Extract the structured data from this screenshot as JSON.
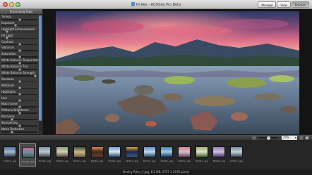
{
  "window": {
    "title": "Hi Res - ACDSee Pro Beta",
    "modes": [
      {
        "label": "Manage",
        "active": false
      },
      {
        "label": "View",
        "active": false
      },
      {
        "label": "Process",
        "active": true
      }
    ]
  },
  "tools_panel": {
    "header": "Processing Tools",
    "tools": [
      {
        "label": "Tuning",
        "level": 0.5
      },
      {
        "label": "Exposure",
        "level": 0.4
      },
      {
        "label": "Highlight Enhancement",
        "level": 0.15
      },
      {
        "label": "Fill Light",
        "level": 0.15
      },
      {
        "label": "Contrast",
        "level": 0.5
      },
      {
        "label": "Vibrance",
        "level": 0.5
      },
      {
        "label": "Saturation",
        "level": 0.5
      },
      {
        "label": "White Balance Temperature",
        "level": 0.5
      },
      {
        "label": "White Balance Tint",
        "level": 0.5
      },
      {
        "label": "White Balance Strength",
        "level": 0.95
      },
      {
        "label": "Shadows",
        "level": 0.5
      },
      {
        "label": "Midtones",
        "level": 0.5
      },
      {
        "label": "Highlights",
        "level": 0.5
      },
      {
        "label": "Hue",
        "level": 0.5
      },
      {
        "label": "Black Level",
        "level": 0.5
      },
      {
        "label": "Midtone Brightness",
        "level": 0.5
      },
      {
        "label": "Recovery",
        "level": 0.3
      },
      {
        "label": "Sharpening",
        "level": 0.5
      },
      {
        "label": "Noise Reduction",
        "level": 0.3
      }
    ]
  },
  "zoom": {
    "value": "20%",
    "level": 0.5
  },
  "filmstrip": {
    "selected_index": 1,
    "items": [
      {
        "caption": "Dmitry...jpg",
        "colors": [
          "#4a6f9c",
          "#2b3e55",
          "#a8b8c8"
        ]
      },
      {
        "caption": "Dmitry...jpg",
        "colors": [
          "#c96a8a",
          "#3f5b4a",
          "#6d8fa8"
        ]
      },
      {
        "caption": "Dmitry...jpg",
        "colors": [
          "#7a8fa5",
          "#3c4a5a",
          "#c0c8d0"
        ]
      },
      {
        "caption": "Dmitry...jpg",
        "colors": [
          "#8b9c6a",
          "#5a4a3a",
          "#d0d0c0"
        ]
      },
      {
        "caption": "Dmitry...jpg",
        "colors": [
          "#3a4a3a",
          "#7a6a4a",
          "#c8b888"
        ]
      },
      {
        "caption": "Dmitry...jpg",
        "colors": [
          "#e08a3a",
          "#6a3a2a",
          "#3a2a22"
        ]
      },
      {
        "caption": "Dmitry...jpg",
        "colors": [
          "#6a9ad0",
          "#2a4a7a",
          "#d8e8f0"
        ]
      },
      {
        "caption": "Dmitry...jpg",
        "colors": [
          "#e0a040",
          "#3a5a8a",
          "#1a2a4a"
        ]
      },
      {
        "caption": "Dmitry...jpg",
        "colors": [
          "#5a8ac8",
          "#2a4a6a",
          "#c0d8e8"
        ]
      },
      {
        "caption": "Dmitry...jpg",
        "colors": [
          "#3a7ad0",
          "#1a3a6a",
          "#a8c8e8"
        ]
      },
      {
        "caption": "Dmitry...jpg",
        "colors": [
          "#d07a9a",
          "#6a4a6a",
          "#d8c0c8"
        ]
      },
      {
        "caption": "Dmitry...jpg",
        "colors": [
          "#9ab070",
          "#4a6a3a",
          "#e0e0c8"
        ]
      },
      {
        "caption": "Dmitry...jpg",
        "colors": [
          "#8a7ab0",
          "#4a3a6a",
          "#d0c0e0"
        ]
      },
      {
        "caption": "Dmitry...jpg",
        "colors": [
          "#6a8a9a",
          "#3a4a5a",
          "#c8d0d8"
        ]
      }
    ]
  },
  "status": {
    "text": "Dmitry-Tolan_1.jpg, 8.5 MB, 5757 x 2978 pixels"
  }
}
